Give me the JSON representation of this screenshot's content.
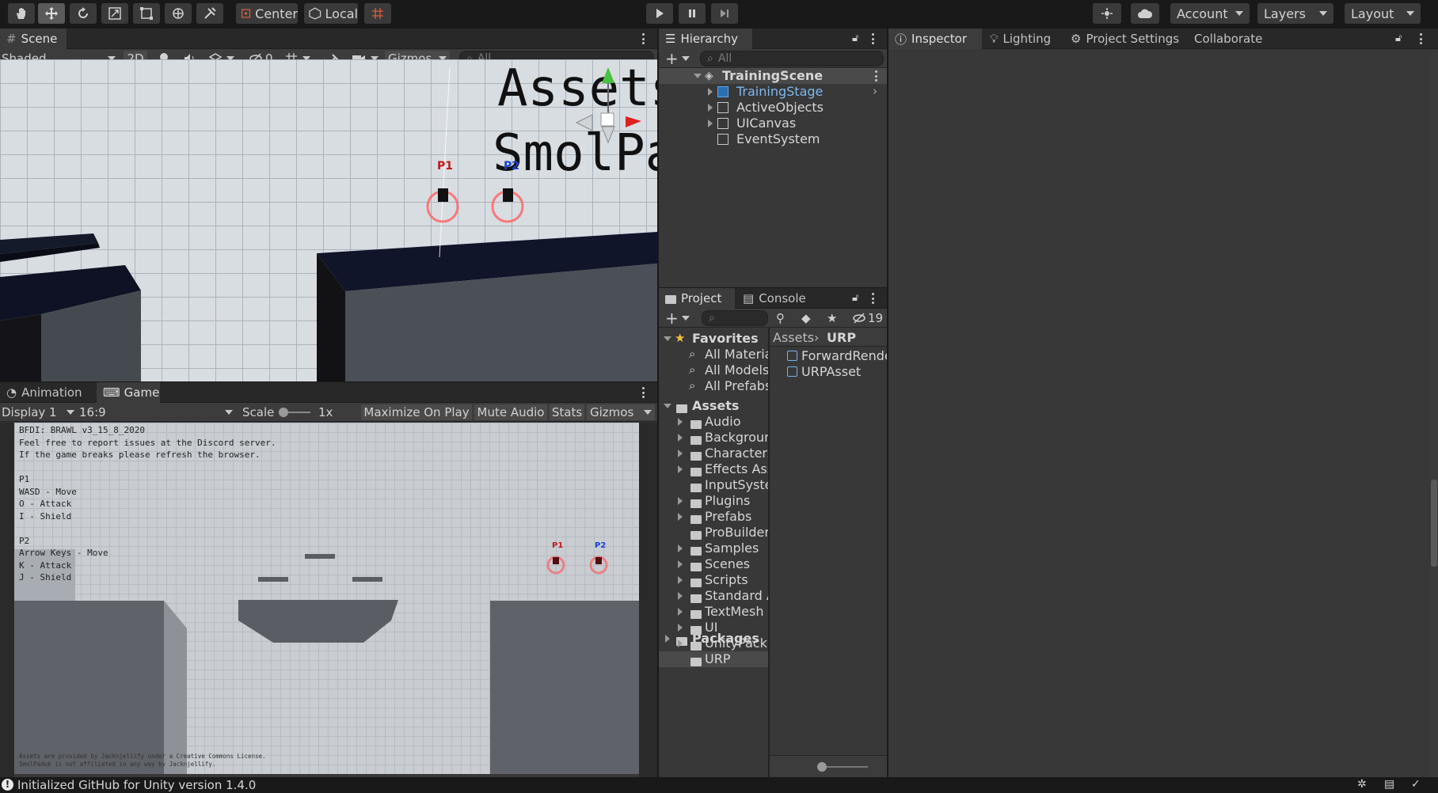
{
  "toolbar": {
    "center_label": "Center",
    "local_label": "Local",
    "account_label": "Account",
    "layers_label": "Layers",
    "layout_label": "Layout"
  },
  "scene": {
    "tab_label": "Scene",
    "shading": "Shaded",
    "mode_2d": "2D",
    "hidden_count": "0",
    "gizmos": "Gizmos",
    "search_placeholder": "All",
    "world_text_1": "Assets",
    "world_text_2": "SmolPac",
    "p1_label": "P1",
    "p2_label": "P2"
  },
  "game": {
    "animation_tab": "Animation",
    "game_tab": "Game",
    "display": "Display 1",
    "aspect": "16:9",
    "scale_label": "Scale",
    "scale_value": "1x",
    "maximize": "Maximize On Play",
    "mute": "Mute Audio",
    "stats": "Stats",
    "gizmos": "Gizmos",
    "overlay_lines": [
      "BFDI: BRAWL v3_15_8_2020",
      "Feel free to report issues at the Discord server.",
      "If the game breaks please refresh the browser.",
      "",
      "P1",
      "WASD - Move",
      "O - Attack",
      "I - Shield",
      "",
      "P2",
      "Arrow Keys - Move",
      "K - Attack",
      "J - Shield"
    ],
    "footer_1": "Assets are provided by Jacknjellify under a Creative Commons License.",
    "footer_2": "SmolPaduk is not affiliated in any way by Jacknjellify.",
    "p1_label": "P1",
    "p2_label": "P2"
  },
  "hierarchy": {
    "tab_label": "Hierarchy",
    "search_placeholder": "All",
    "scene_name": "TrainingScene",
    "items": [
      "TrainingStage",
      "ActiveObjects",
      "UICanvas",
      "EventSystem"
    ]
  },
  "project": {
    "project_tab": "Project",
    "console_tab": "Console",
    "hidden_count": "19",
    "favorites_label": "Favorites",
    "favorites": [
      "All Materia",
      "All Models",
      "All Prefabs"
    ],
    "assets_label": "Assets",
    "folders": [
      "Audio",
      "Backgroun",
      "Characters",
      "Effects Ass",
      "InputSyste",
      "Plugins",
      "Prefabs",
      "ProBuilder",
      "Samples",
      "Scenes",
      "Scripts",
      "Standard A",
      "TextMesh",
      "UI",
      "UnityPack",
      "URP"
    ],
    "packages_label": "Packages",
    "breadcrumb_root": "Assets",
    "breadcrumb_leaf": "URP",
    "files": [
      "ForwardRende",
      "URPAsset"
    ]
  },
  "inspector": {
    "inspector_tab": "Inspector",
    "lighting_tab": "Lighting",
    "project_settings_tab": "Project Settings",
    "collaborate_tab": "Collaborate"
  },
  "status": {
    "message": "Initialized GitHub for Unity version 1.4.0"
  }
}
